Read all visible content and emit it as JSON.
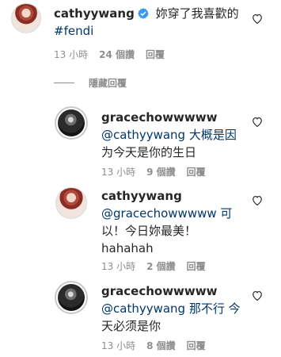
{
  "comments": [
    {
      "username": "cathyywang",
      "verified": true,
      "text_lines": [
        "妳穿了我喜歡的",
        "#fendi"
      ],
      "time": "13 小時",
      "likes": "24 個讚",
      "reply": "回覆"
    },
    {
      "username": "gracechowwwww",
      "text_lines": [
        "@cathyywang 大概是因",
        "为今天是你的生日"
      ],
      "time": "13 小時",
      "likes": "9 個讚",
      "reply": "回覆"
    },
    {
      "username": "cathyywang",
      "text_lines": [
        "@gracechowwwww 可",
        "以！今日妳最美！",
        "hahahah"
      ],
      "time": "13 小時",
      "likes": "2 個讚",
      "reply": "回覆"
    },
    {
      "username": "gracechowwwww",
      "text_lines": [
        "@cathyywang 那不行 今",
        "天必须是你"
      ],
      "time": "13 小時",
      "likes": "8 個讚",
      "reply": "回覆"
    }
  ],
  "hide_replies": "隱藏回覆",
  "colors": {
    "link": "#00376b",
    "meta": "#8e8e8e",
    "verified": "#3897f0"
  },
  "icons": [
    "heart-icon",
    "verified-badge-icon"
  ]
}
